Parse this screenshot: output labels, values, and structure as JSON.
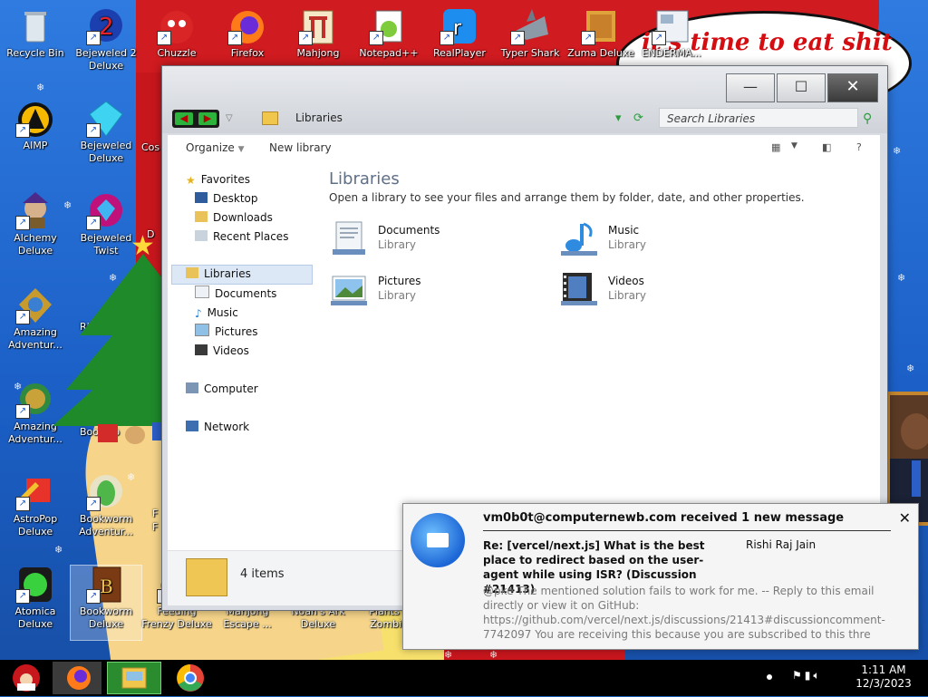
{
  "desktop": {
    "wallpaper_text": "it's time to eat shit",
    "icons": [
      {
        "label": "Recycle Bin",
        "icon": "recycle-bin-icon"
      },
      {
        "label": "Bejeweled 2 Deluxe",
        "icon": "bejeweled-2-icon"
      },
      {
        "label": "Chuzzle",
        "icon": "chuzzle-icon"
      },
      {
        "label": "Firefox",
        "icon": "firefox-icon"
      },
      {
        "label": "Mahjong",
        "icon": "mahjong-icon"
      },
      {
        "label": "Notepad++",
        "icon": "notepadpp-icon"
      },
      {
        "label": "RealPlayer",
        "icon": "realplayer-icon"
      },
      {
        "label": "Typer Shark",
        "icon": "typer-shark-icon"
      },
      {
        "label": "Zuma Deluxe",
        "icon": "zuma-icon"
      },
      {
        "label": "ENDERMA...",
        "icon": "enderma-icon"
      },
      {
        "label": "AIMP",
        "icon": "aimp-icon"
      },
      {
        "label": "Bejeweled Deluxe",
        "icon": "bejeweled-icon"
      },
      {
        "label": "Cos",
        "icon": "cos-icon"
      },
      {
        "label": "Alchemy Deluxe",
        "icon": "alchemy-icon"
      },
      {
        "label": "Bejeweled Twist",
        "icon": "bejeweled-twist-icon"
      },
      {
        "label": "Amazing Adventur...",
        "icon": "amazing-adventures-icon"
      },
      {
        "label": "Amazing Adventur...",
        "icon": "amazing-adventures-2-icon"
      },
      {
        "label": "AstroPop Deluxe",
        "icon": "astropop-icon"
      },
      {
        "label": "Bookworm Adventur...",
        "icon": "bookworm-adventures-icon"
      },
      {
        "label": "Atomica Deluxe",
        "icon": "atomica-icon"
      },
      {
        "label": "Bookworm Deluxe",
        "icon": "bookworm-icon"
      },
      {
        "label": "Feeding Frenzy Deluxe",
        "icon": "feeding-frenzy-icon"
      },
      {
        "label": "Mahjong Escape ...",
        "icon": "mahjong-escape-icon"
      },
      {
        "label": "Noah's Ark Deluxe",
        "icon": "noahs-ark-icon"
      },
      {
        "label": "Plants v Zombie",
        "icon": "plants-zombies-icon"
      }
    ],
    "partial_labels": [
      "Ri",
      "Booksto",
      "D",
      "F",
      "F"
    ]
  },
  "explorer": {
    "breadcrumb": "Libraries",
    "search_placeholder": "Search Libraries",
    "toolbar": {
      "organize": "Organize",
      "new_library": "New library",
      "help": "?"
    },
    "nav": {
      "favorites": "Favorites",
      "favorites_items": [
        "Desktop",
        "Downloads",
        "Recent Places"
      ],
      "libraries": "Libraries",
      "libraries_items": [
        "Documents",
        "Music",
        "Pictures",
        "Videos"
      ],
      "computer": "Computer",
      "network": "Network"
    },
    "main": {
      "title": "Libraries",
      "subtitle": "Open a library to see your files and arrange them by folder, date, and other properties.",
      "libraries": [
        {
          "name": "Documents",
          "type": "Library"
        },
        {
          "name": "Music",
          "type": "Library"
        },
        {
          "name": "Pictures",
          "type": "Library"
        },
        {
          "name": "Videos",
          "type": "Library"
        }
      ]
    },
    "details": {
      "count": "4 items"
    }
  },
  "notification": {
    "header": "vm0b0t@computernewb.com received 1 new message",
    "subject": "Re: [vercel/next.js] What is the best place to redirect based on the user-agent while using ISR? (Discussion #21413)",
    "sender": "Rishi Raj Jain",
    "body": "@pke The mentioned solution fails to work for me. -- Reply to this email directly or view it on GitHub: https://github.com/vercel/next.js/discussions/21413#discussioncomment-7742097 You are receiving this because you are subscribed to this thre",
    "close": "✕"
  },
  "taskbar": {
    "time": "1:11 AM",
    "date": "12/3/2023"
  }
}
